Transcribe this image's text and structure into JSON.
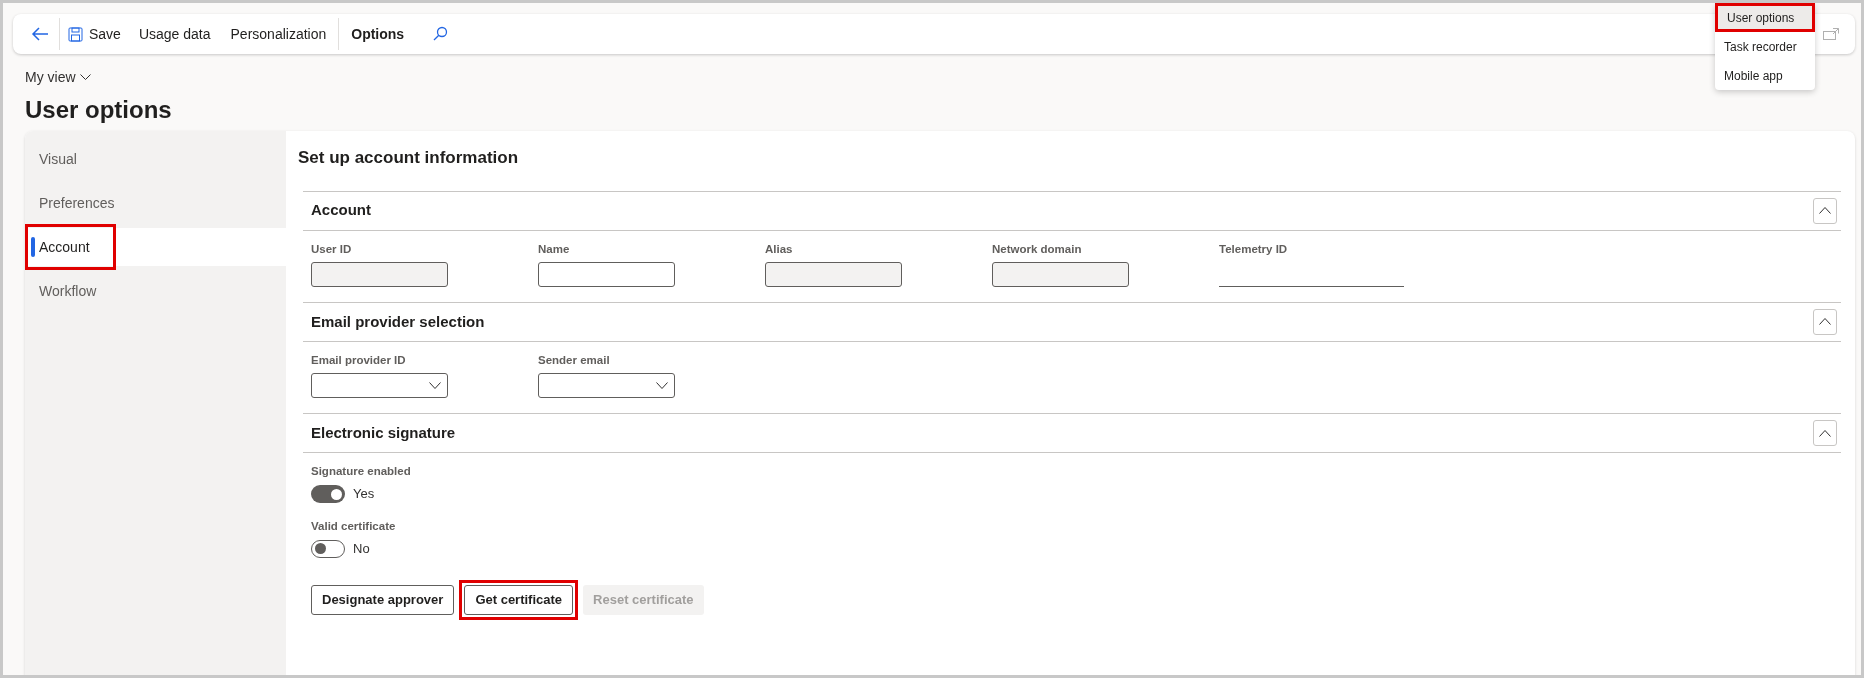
{
  "toolbar": {
    "items": [
      {
        "kind": "back"
      },
      {
        "kind": "save",
        "label": "Save"
      },
      {
        "kind": "text",
        "label": "Usage data"
      },
      {
        "kind": "text",
        "label": "Personalization"
      },
      {
        "kind": "bold",
        "label": "Options"
      },
      {
        "kind": "search"
      }
    ]
  },
  "options_menu": {
    "items": [
      {
        "label": "User options",
        "selected": true,
        "highlighted": true
      },
      {
        "label": "Task recorder",
        "selected": false,
        "highlighted": false
      },
      {
        "label": "Mobile app",
        "selected": false,
        "highlighted": false
      }
    ]
  },
  "view_selector": "My view",
  "page_title": "User options",
  "sidebar": {
    "items": [
      {
        "label": "Visual",
        "selected": false,
        "highlighted": false
      },
      {
        "label": "Preferences",
        "selected": false,
        "highlighted": false
      },
      {
        "label": "Account",
        "selected": true,
        "highlighted": true
      },
      {
        "label": "Workflow",
        "selected": false,
        "highlighted": false
      }
    ]
  },
  "content_title": "Set up account information",
  "sections": [
    {
      "title": "Account",
      "expanded": true,
      "fields": [
        {
          "label": "User ID",
          "kind": "disabled"
        },
        {
          "label": "Name",
          "kind": "text"
        },
        {
          "label": "Alias",
          "kind": "disabled"
        },
        {
          "label": "Network domain",
          "kind": "disabled"
        },
        {
          "label": "Telemetry ID",
          "kind": "underline"
        }
      ]
    },
    {
      "title": "Email provider selection",
      "expanded": true,
      "fields": [
        {
          "label": "Email provider ID",
          "kind": "dropdown"
        },
        {
          "label": "Sender email",
          "kind": "dropdown"
        }
      ]
    },
    {
      "title": "Electronic signature",
      "expanded": true,
      "toggles": [
        {
          "label": "Signature enabled",
          "on": true,
          "value": "Yes"
        },
        {
          "label": "Valid certificate",
          "on": false,
          "value": "No"
        }
      ],
      "buttons": [
        {
          "label": "Designate approver",
          "disabled": false,
          "highlighted": false
        },
        {
          "label": "Get certificate",
          "disabled": false,
          "highlighted": true
        },
        {
          "label": "Reset certificate",
          "disabled": true,
          "highlighted": false
        }
      ]
    }
  ]
}
